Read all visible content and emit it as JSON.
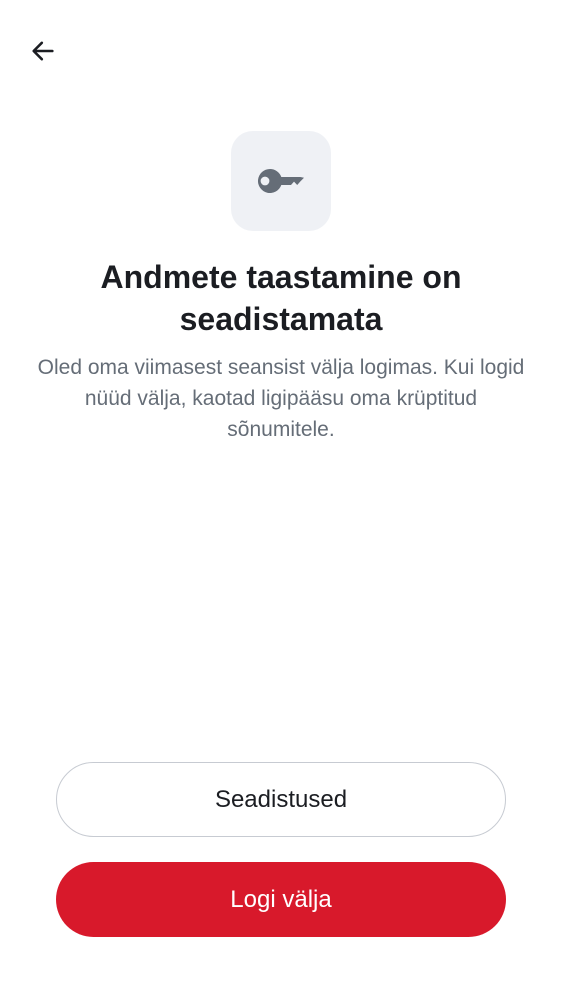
{
  "header": {
    "back_icon": "arrow-left-icon"
  },
  "hero": {
    "icon": "key-icon",
    "icon_bg_color": "#eff1f5",
    "icon_color": "#656d77"
  },
  "content": {
    "title": "Andmete taastamine on seadistamata",
    "description": "Oled oma viimasest seansist välja logimas. Kui logid nüüd välja, kaotad ligipääsu oma krüptitud sõnumitele."
  },
  "actions": {
    "settings_label": "Seadistused",
    "logout_label": "Logi välja",
    "primary_color": "#d8192b"
  }
}
